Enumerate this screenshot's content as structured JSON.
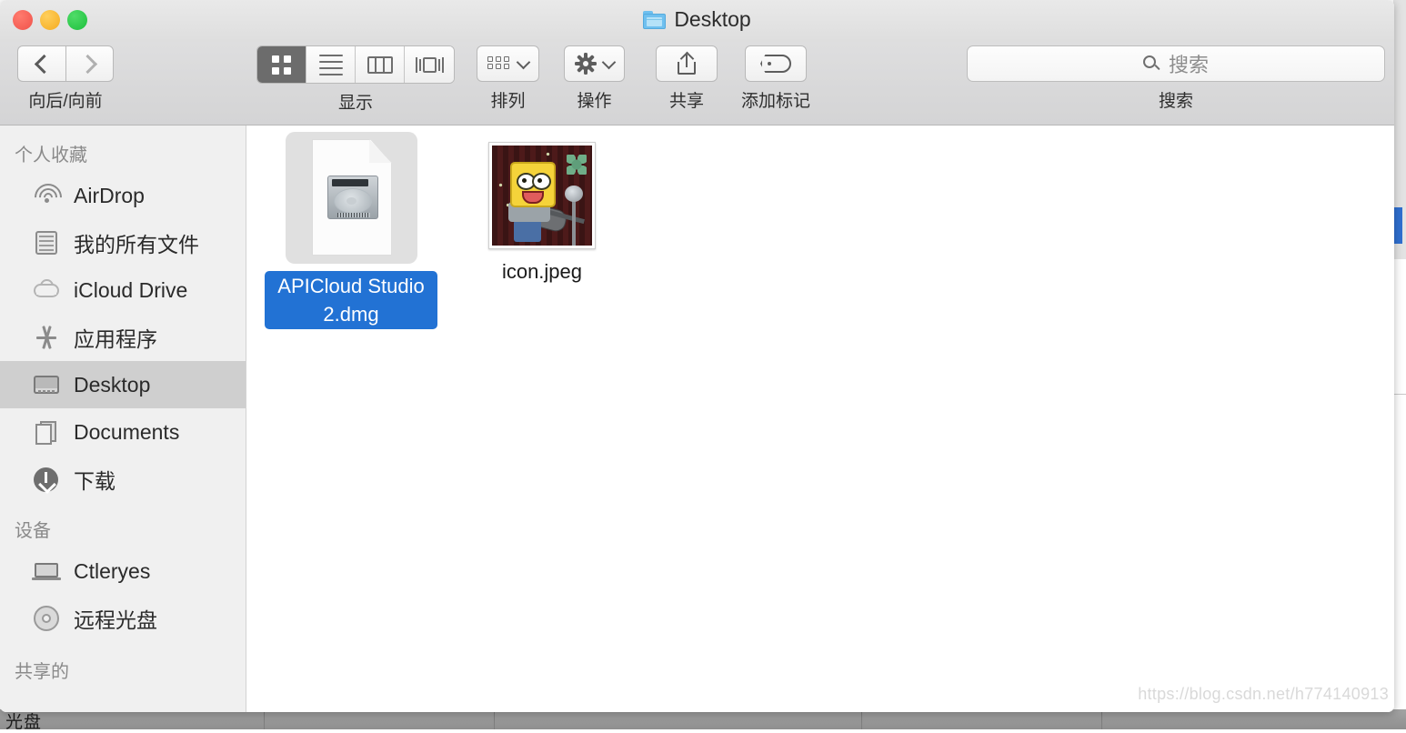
{
  "window": {
    "title": "Desktop",
    "folder_icon": "folder-icon",
    "traffic_lights": {
      "close": "close-button",
      "minimize": "minimize-button",
      "maximize": "maximize-button"
    }
  },
  "toolbar": {
    "nav": {
      "back_icon": "chevron-left-icon",
      "forward_icon": "chevron-right-icon",
      "label": "向后/向前"
    },
    "view": {
      "label": "显示",
      "modes": [
        {
          "name": "icon-view",
          "icon": "grid-icon",
          "active": true
        },
        {
          "name": "list-view",
          "icon": "list-icon",
          "active": false
        },
        {
          "name": "column-view",
          "icon": "columns-icon",
          "active": false
        },
        {
          "name": "coverflow-view",
          "icon": "coverflow-icon",
          "active": false
        }
      ]
    },
    "arrange": {
      "label": "排列",
      "icon": "arrange-icon",
      "chevron": "chevron-down-icon"
    },
    "action": {
      "label": "操作",
      "icon": "gear-icon",
      "chevron": "chevron-down-icon"
    },
    "share": {
      "label": "共享",
      "icon": "share-icon"
    },
    "tag": {
      "label": "添加标记",
      "icon": "tag-icon"
    },
    "search": {
      "label": "搜索",
      "placeholder": "搜索",
      "value": "",
      "icon": "search-icon"
    }
  },
  "sidebar": {
    "sections": [
      {
        "heading": "个人收藏",
        "items": [
          {
            "label": "AirDrop",
            "icon": "airdrop-icon",
            "selected": false
          },
          {
            "label": "我的所有文件",
            "icon": "all-my-files-icon",
            "selected": false
          },
          {
            "label": "iCloud Drive",
            "icon": "cloud-icon",
            "selected": false
          },
          {
            "label": "应用程序",
            "icon": "applications-icon",
            "selected": false
          },
          {
            "label": "Desktop",
            "icon": "desktop-icon",
            "selected": true
          },
          {
            "label": "Documents",
            "icon": "documents-icon",
            "selected": false
          },
          {
            "label": "下载",
            "icon": "downloads-icon",
            "selected": false
          }
        ]
      },
      {
        "heading": "设备",
        "items": [
          {
            "label": "Ctleryes",
            "icon": "laptop-icon",
            "selected": false
          },
          {
            "label": "远程光盘",
            "icon": "disc-icon",
            "selected": false
          }
        ]
      },
      {
        "heading": "共享的",
        "items": []
      }
    ]
  },
  "content": {
    "files": [
      {
        "name": "APICloud Studio 2.dmg",
        "icon": "disk-image-icon",
        "selected": true
      },
      {
        "name": "icon.jpeg",
        "icon": "image-thumbnail",
        "selected": false
      }
    ]
  },
  "desktop": {
    "watermark": "https://blog.csdn.net/h774140913",
    "bottom_text": "光盘"
  },
  "colors": {
    "selection_blue": "#2272d4",
    "sidebar_selected": "#cfcfcf",
    "toolbar_bg": "#d9d9da",
    "active_view_button": "#6c6c6c"
  }
}
